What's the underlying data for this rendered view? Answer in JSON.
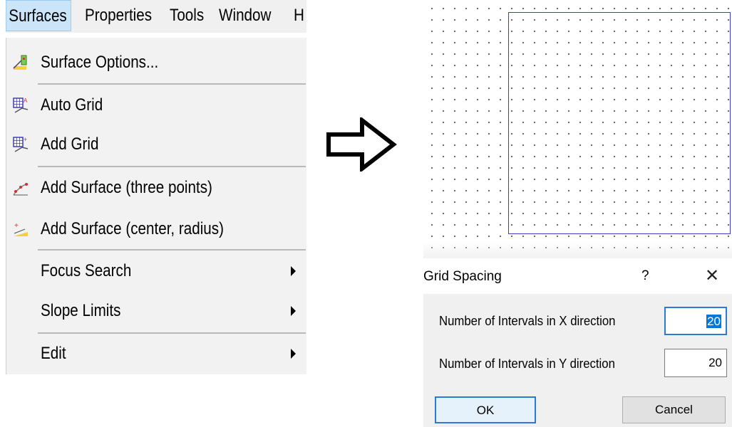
{
  "menubar": {
    "items": [
      "Surfaces",
      "Properties",
      "Tools",
      "Window",
      "H"
    ]
  },
  "menu": {
    "items": [
      {
        "label": "Surface Options...",
        "icon": "surface-options-icon"
      },
      {
        "label": "Auto Grid",
        "icon": "auto-grid-icon"
      },
      {
        "label": "Add Grid",
        "icon": "add-grid-icon"
      },
      {
        "label": "Add Surface (three points)",
        "icon": "add-surface-three-points-icon"
      },
      {
        "label": "Add Surface (center, radius)",
        "icon": "add-surface-center-radius-icon"
      },
      {
        "label": "Focus Search",
        "submenu": true
      },
      {
        "label": "Slope Limits",
        "submenu": true
      },
      {
        "label": "Edit",
        "submenu": true
      }
    ]
  },
  "arrow_icon": "right-arrow-icon",
  "dialog": {
    "title": "Grid Spacing",
    "help": "?",
    "close": "✕",
    "x_label": "Number of Intervals in X direction",
    "x_value": "20",
    "y_label": "Number of Intervals in Y direction",
    "y_value": "20",
    "ok": "OK",
    "cancel": "Cancel"
  },
  "colors": {
    "menu_highlight": "#cce4f7",
    "grid_border": "#3d3dc0",
    "focus_blue": "#0078d7"
  }
}
